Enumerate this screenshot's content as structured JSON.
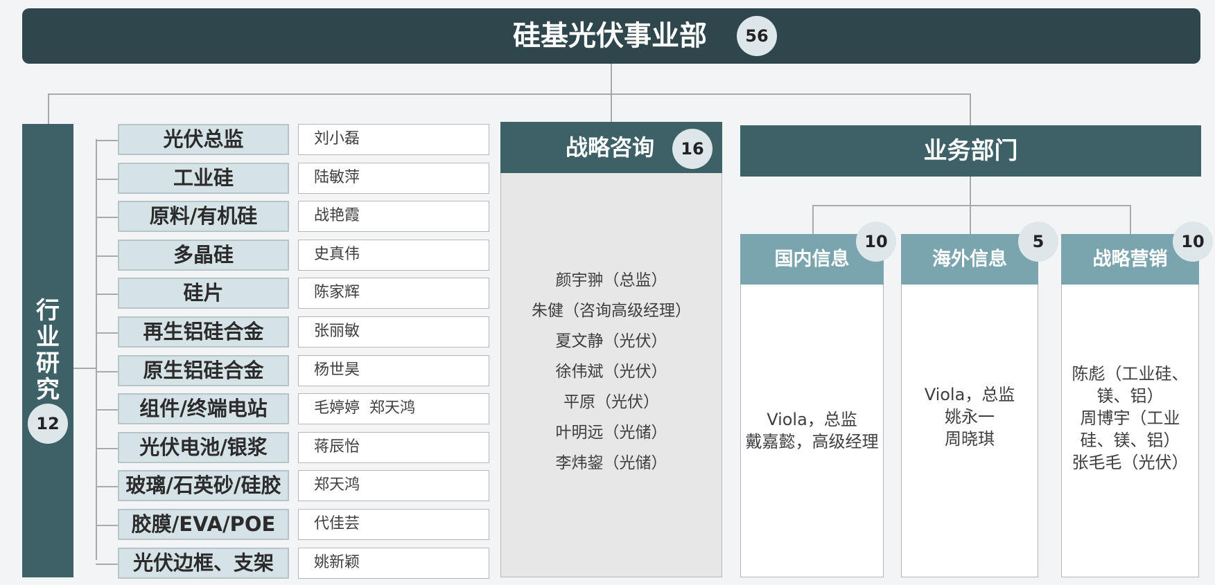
{
  "header": {
    "title": "硅基光伏事业部",
    "count": "56"
  },
  "industry_research": {
    "title": "行业研究",
    "title_chars": [
      "行",
      "业",
      "研",
      "究"
    ],
    "count": "12",
    "rows": [
      {
        "category": "光伏总监",
        "names": "刘小磊"
      },
      {
        "category": "工业硅",
        "names": "陆敏萍"
      },
      {
        "category": "原料/有机硅",
        "names": "战艳霞"
      },
      {
        "category": "多晶硅",
        "names": "史真伟"
      },
      {
        "category": "硅片",
        "names": "陈家辉"
      },
      {
        "category": "再生铝硅合金",
        "names": "张丽敏"
      },
      {
        "category": "原生铝硅合金",
        "names": "杨世昊"
      },
      {
        "category": "组件/终端电站",
        "names": "毛婷婷  郑天鸿"
      },
      {
        "category": "光伏电池/银浆",
        "names": "蒋辰怡"
      },
      {
        "category": "玻璃/石英砂/硅胶",
        "names": "郑天鸿"
      },
      {
        "category": "胶膜/EVA/POE",
        "names": "代佳芸"
      },
      {
        "category": "光伏边框、支架",
        "names": "姚新颖"
      }
    ]
  },
  "strategy_consulting": {
    "title": "战略咨询",
    "count": "16",
    "members": [
      "颜宇翀（总监）",
      "朱健（咨询高级经理）",
      "夏文静（光伏）",
      "徐伟斌（光伏）",
      "平原（光伏）",
      "叶明远（光储）",
      "李炜鋆（光储）"
    ]
  },
  "business": {
    "title": "业务部门",
    "units": [
      {
        "title": "国内信息",
        "count": "10",
        "members": [
          "Viola，总监",
          "戴嘉懿，高级经理"
        ]
      },
      {
        "title": "海外信息",
        "count": "5",
        "members": [
          "Viola，总监",
          "姚永一",
          "周晓琪"
        ]
      },
      {
        "title": "战略营销",
        "count": "10",
        "members": [
          "陈彪（工业硅、",
          "镁、铝）",
          "周博宇（工业",
          "硅、镁、铝）",
          "张毛毛（光伏）"
        ]
      }
    ]
  }
}
